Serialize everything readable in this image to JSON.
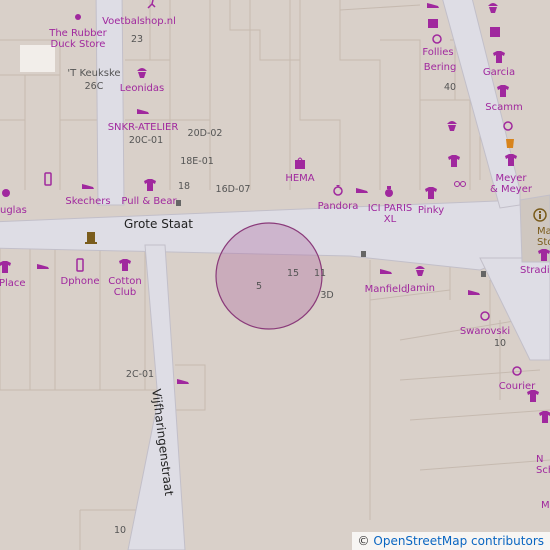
{
  "map": {
    "streets": {
      "grote_staat": "Grote Staat",
      "vijfharingenstraat": "Vijfharingenstraat"
    },
    "pois": [
      {
        "id": "the-rubber-duck-store",
        "label": "The Rubber\nDuck Store",
        "icon": "dot-icon"
      },
      {
        "id": "voetbalshop",
        "label": "Voetbalshop.nl",
        "icon": "running-icon"
      },
      {
        "id": "t-keukske",
        "label": "'T Keukske",
        "icon": "none"
      },
      {
        "id": "leonidas",
        "label": "Leonidas",
        "icon": "cupcake-icon"
      },
      {
        "id": "snkr-atelier",
        "label": "SNKR-ATELIER",
        "icon": "shoe-icon"
      },
      {
        "id": "hema",
        "label": "HEMA",
        "icon": "shopping-bag-icon"
      },
      {
        "id": "pandora",
        "label": "Pandora",
        "icon": "ring-icon"
      },
      {
        "id": "ici-paris-xl",
        "label": "ICI PARIS\nXL",
        "icon": "perfume-icon"
      },
      {
        "id": "pinky",
        "label": "Pinky",
        "icon": "shirt-icon"
      },
      {
        "id": "follies",
        "label": "Follies",
        "icon": "ring-icon"
      },
      {
        "id": "bering",
        "label": "Bering",
        "icon": "none"
      },
      {
        "id": "garcia",
        "label": "Garcia",
        "icon": "shirt-icon"
      },
      {
        "id": "scamm",
        "label": "Scamm",
        "icon": "shirt-icon"
      },
      {
        "id": "meyer-meyer",
        "label": "Meyer\n& Meyer",
        "icon": "shirt-icon"
      },
      {
        "id": "maastricht-store",
        "label": "Maastri\nStore",
        "icon": "info-icon"
      },
      {
        "id": "stradiv",
        "label": "Stradiv",
        "icon": "shirt-icon"
      },
      {
        "id": "douglas",
        "label": "uglas",
        "icon": "perfume-icon"
      },
      {
        "id": "skechers",
        "label": "Skechers",
        "icon": "shoe-icon"
      },
      {
        "id": "pull-bear",
        "label": "Pull & Bear",
        "icon": "shirt-icon"
      },
      {
        "id": "place",
        "label": "Place",
        "icon": "shirt-icon"
      },
      {
        "id": "dphone",
        "label": "Dphone",
        "icon": "phone-icon"
      },
      {
        "id": "cotton-club",
        "label": "Cotton\nClub",
        "icon": "shirt-icon"
      },
      {
        "id": "manfield",
        "label": "Manfield",
        "icon": "shoe-icon"
      },
      {
        "id": "jamin",
        "label": "Jamin",
        "icon": "cupcake-icon"
      },
      {
        "id": "swarovski",
        "label": "Swarovski",
        "icon": "ring-icon"
      },
      {
        "id": "courier",
        "label": "Courier",
        "icon": "ring-icon"
      },
      {
        "id": "n-sch",
        "label": "N\nSch",
        "icon": "none"
      },
      {
        "id": "m",
        "label": "M",
        "icon": "none"
      }
    ],
    "house_numbers": [
      "23",
      "26C",
      "20C-01",
      "20D-02",
      "18E-01",
      "18",
      "16D-07",
      "40",
      "5",
      "15",
      "11",
      "3D",
      "2C-01",
      "10",
      "10"
    ],
    "marker": {
      "label": "location-circle",
      "color": "#b06aa0"
    },
    "colors": {
      "background": "#d9d0c9",
      "road": "#dedde5",
      "shop": "#a0289e",
      "road_edge": "#c2bfc9"
    }
  },
  "attribution": {
    "symbol": "©",
    "text": "OpenStreetMap contributors"
  }
}
